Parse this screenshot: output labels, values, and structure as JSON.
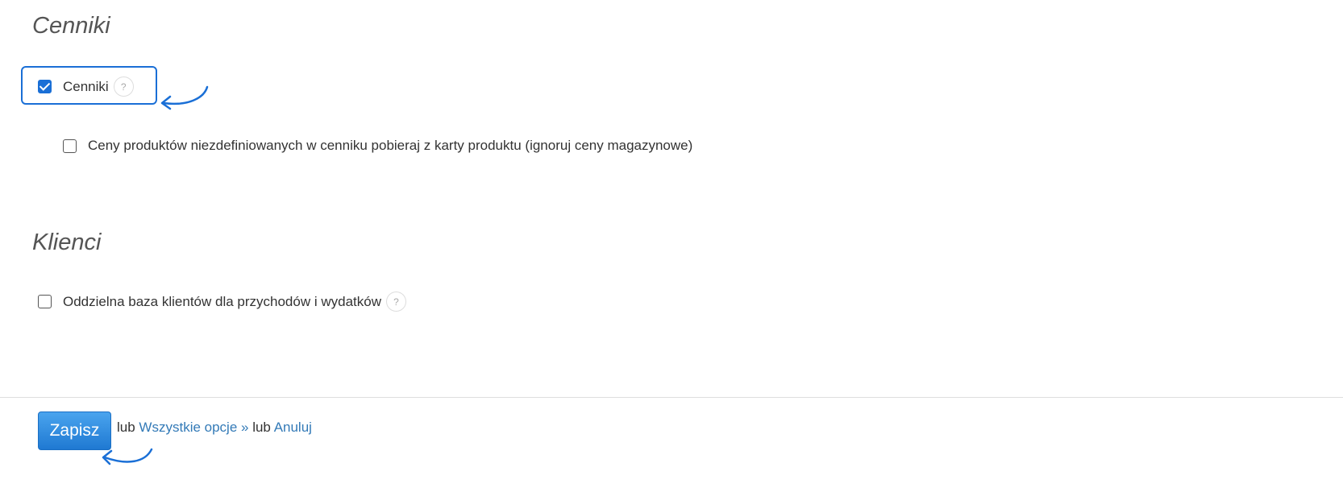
{
  "sections": {
    "cenniki": {
      "heading": "Cenniki",
      "main_option": {
        "label": "Cenniki",
        "checked": true,
        "help": "?"
      },
      "sub_option": {
        "label": "Ceny produktów niezdefiniowanych w cenniku pobieraj z karty produktu (ignoruj ceny magazynowe)",
        "checked": false
      }
    },
    "klienci": {
      "heading": "Klienci",
      "option": {
        "label": "Oddzielna baza klientów dla przychodów i wydatków",
        "checked": false,
        "help": "?"
      }
    }
  },
  "footer": {
    "save_label": "Zapisz",
    "or_1": "lub",
    "all_options_label": "Wszystkie opcje »",
    "or_2": "lub",
    "cancel_label": "Anuluj"
  },
  "colors": {
    "accent": "#1a6fd6",
    "link": "#337ab7",
    "heading": "#555555"
  }
}
